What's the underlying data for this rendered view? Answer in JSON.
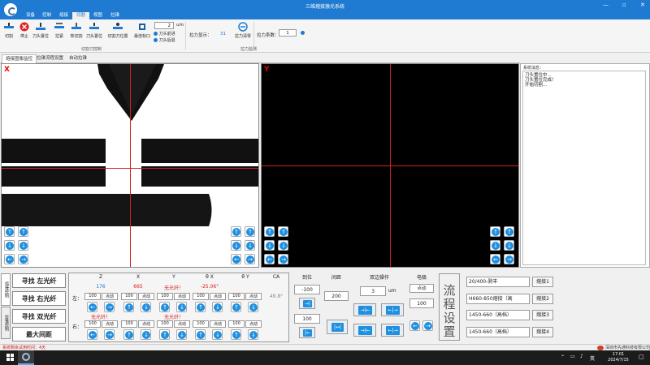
{
  "window": {
    "title": "三维熔接激光系统",
    "controls": [
      "—",
      "▫",
      "✕"
    ]
  },
  "menu": [
    "设备",
    "控制",
    "熔接",
    "切割",
    "视图",
    "拉锥"
  ],
  "menu_active": 3,
  "ribbon": {
    "buttons": [
      "切割",
      "停止",
      "刀头置位",
      "拉紧",
      "软切割",
      "刀头置位",
      "切割刀位置",
      "最佳标口"
    ],
    "spin_value": "2",
    "spin_unit": "um",
    "radio1": "刀头前进",
    "radio2": "刀头后退",
    "group1": "切割刀控制",
    "tension_display_label": "拉力显示：",
    "tension_display_value": "31",
    "tension_zero": "拉力清零",
    "tension_coef_label": "拉力系数：",
    "tension_coef_value": "1",
    "group2": "拉力监测"
  },
  "tabs": [
    "熔接图像监控",
    "拉锥流程设置",
    "自动拉锥"
  ],
  "views": {
    "left_label": "X",
    "right_label": "Y"
  },
  "messages": {
    "header": "系统消息：",
    "lines": [
      "刀头置位中...",
      "刀头置位完成！",
      "开始切割..."
    ]
  },
  "side_tabs": [
    "熔接控制",
    "拉锥控制"
  ],
  "find_buttons": [
    "寻找 左光纤",
    "寻找 右光纤",
    "寻找 双光纤",
    "最大间距"
  ],
  "motor": {
    "headers": [
      "Z",
      "X",
      "Y",
      "θ X",
      "θ Y",
      "CA"
    ],
    "readouts": [
      "176",
      "665",
      "无光纤！",
      "-25.06°"
    ],
    "ca_value": "49.8°",
    "left_label": "左：",
    "right_label": "右：",
    "right_status_y": "无光纤！",
    "right_status_x": "无光纤！",
    "step": "100",
    "jog": "点动"
  },
  "position": {
    "title": "到位",
    "value1": "-100",
    "value2": "100"
  },
  "gap": {
    "title": "间距",
    "value": "200"
  },
  "dual": {
    "title": "双边操作",
    "value": "3",
    "unit": "um"
  },
  "electrode": {
    "title": "电极",
    "jog": "点动",
    "value": "100"
  },
  "process": {
    "label": "流程设置"
  },
  "programs": [
    {
      "select": "20/400-剥丰",
      "button": "熔接1"
    },
    {
      "select": "H660-850熔接（高",
      "button": "熔接2"
    },
    {
      "select": "1450-660（高档）",
      "button": "熔接3"
    },
    {
      "select": "1450-660（高档）",
      "button": "熔接4"
    }
  ],
  "status": {
    "left": "系统剩余试用时间：4天",
    "right": "深圳市先通科技有限公司"
  },
  "taskbar": {
    "time": "17:01",
    "date": "2024/7/15",
    "lang": "英"
  },
  "colors": {
    "accent": "#1f7bd1",
    "crosshair": "#d0221e",
    "warning": "#d0221e"
  }
}
